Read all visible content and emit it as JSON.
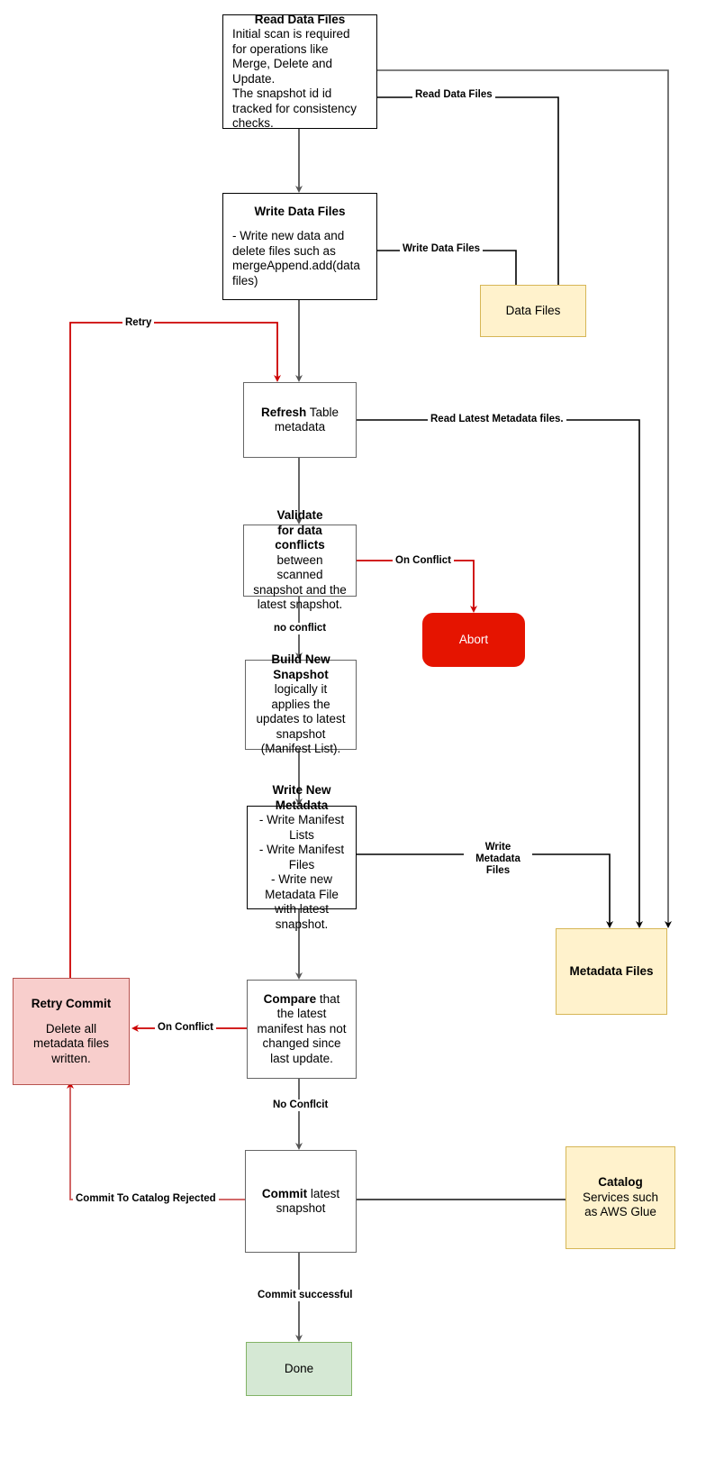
{
  "diagram": {
    "title": "Apache Iceberg write / commit flow",
    "colors": {
      "store_fill": "#fff2cc",
      "store_stroke": "#d6b656",
      "done_fill": "#d5e8d4",
      "done_stroke": "#82b366",
      "abort_fill": "#e51400",
      "retry_fill": "#f8cecc",
      "retry_stroke": "#b85450",
      "error_edge": "#cc0000",
      "normal_edge": "#666666",
      "black_edge": "#000000"
    }
  },
  "nodes": {
    "read_data_files": {
      "title": "Read Data Files",
      "body": "Initial scan is required for operations like Merge, Delete and Update.\nThe snapshot id id tracked for consistency checks."
    },
    "write_data_files": {
      "title": "Write Data Files",
      "body": "- Write new data and delete files such as mergeAppend.add(data files)"
    },
    "refresh": {
      "title": "Refresh",
      "rest": " Table",
      "line2": "metadata"
    },
    "validate": {
      "title_line1": "Validate",
      "title_line2": "for data conflicts",
      "body": "between scanned snapshot and the latest snapshot."
    },
    "build_new_snapshot": {
      "title": "Build New Snapshot",
      "body": "logically it applies the updates to latest snapshot (Manifest List)."
    },
    "write_new_metadata": {
      "title": "Write New Metadata",
      "body": "- Write Manifest Lists\n- Write Manifest Files\n- Write new Metadata File with latest snapshot."
    },
    "compare": {
      "title": "Compare",
      "rest": " that the latest manifest has not changed since last update."
    },
    "commit": {
      "title": "Commit",
      "rest": " latest",
      "line2": "snapshot"
    },
    "retry_commit": {
      "title": "Retry Commit",
      "body": "Delete all metadata files written."
    },
    "abort": {
      "label": "Abort"
    },
    "data_files": {
      "label": "Data Files"
    },
    "metadata_files": {
      "label": "Metadata Files"
    },
    "catalog": {
      "title": "Catalog",
      "rest": " Services such as AWS Glue"
    },
    "done": {
      "label": "Done"
    }
  },
  "edge_labels": {
    "read_data_files": "Read Data Files",
    "write_data_files": "Write Data Files",
    "retry": "Retry",
    "read_latest_metadata": "Read Latest Metadata files.",
    "on_conflict_validate": "On Conflict",
    "no_conflict_validate": "no conflict",
    "write_metadata_files": "Write\nMetadata\nFiles",
    "on_conflict_compare": "On Conflict",
    "no_conflict_compare": "No Conflcit",
    "commit_to_catalog_rejected": "Commit To Catalog Rejected",
    "commit_successful": "Commit successful"
  }
}
